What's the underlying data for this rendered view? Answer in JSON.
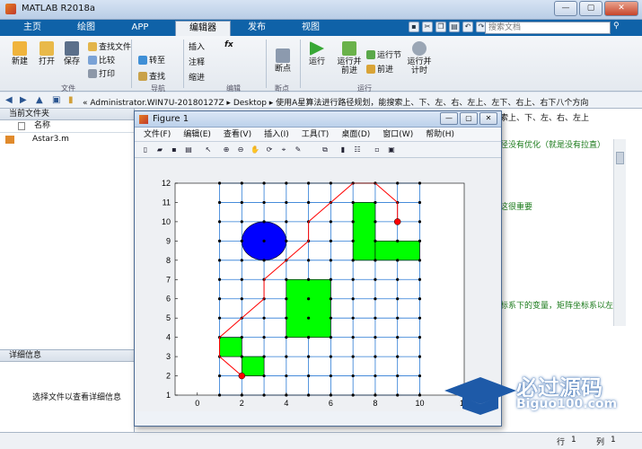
{
  "window": {
    "title": "MATLAB R2018a",
    "min": "—",
    "max": "▢",
    "close": "✕"
  },
  "tabs": [
    "主页",
    "绘图",
    "APP",
    "编辑器",
    "发布",
    "视图"
  ],
  "search": {
    "placeholder": "搜索文档"
  },
  "ribbon": {
    "new": "新建",
    "open": "打开",
    "save": "保存",
    "find_files": "查找文件",
    "compare": "比较",
    "print": "打印",
    "goto": "转至",
    "find": "查找",
    "insert": "插入",
    "comment": "注释",
    "indent": "缩进",
    "breakpoints": "断点",
    "run": "运行",
    "run_advance_1": "运行并",
    "run_advance_2": "前进",
    "run_section": "运行节",
    "advance": "前进",
    "run_time_1": "运行并",
    "run_time_2": "计时",
    "group_file": "文件",
    "group_nav": "导航",
    "group_edit": "编辑",
    "group_bp": "断点",
    "group_run": "运行"
  },
  "address": {
    "path": "« Administrator.WIN7U-20180127Z ▸ Desktop ▸ 使用A星算法进行路径规划，能搜索上、下、左、右、左上、左下、右上、右下八个方向"
  },
  "left_panel": {
    "header": "当前文件夹",
    "col_name": "名称",
    "files": [
      "Astar3.m"
    ],
    "detail_header": "详细信息",
    "detail_text": "选择文件以查看详细信息"
  },
  "editor": {
    "lines": [
      "索上、下、左、右、左上",
      "径没有优化（就是没有拉直）",
      "这很重要",
      "标系下的变量，矩阵坐标系以左"
    ]
  },
  "statusbar": {
    "row_label": "行",
    "row": "1",
    "col_label": "列",
    "col": "1"
  },
  "figure": {
    "title": "Figure 1",
    "menu": [
      "文件(F)",
      "编辑(E)",
      "查看(V)",
      "插入(I)",
      "工具(T)",
      "桌面(D)",
      "窗口(W)",
      "帮助(H)"
    ]
  },
  "watermark": {
    "text": "必过源码",
    "url": "Biguo100.com"
  },
  "chart_data": {
    "type": "scatter",
    "title": "",
    "xlabel": "",
    "ylabel": "",
    "xlim": [
      -1,
      12
    ],
    "ylim": [
      1,
      12
    ],
    "x_ticks": [
      0,
      2,
      4,
      6,
      8,
      10,
      12
    ],
    "y_ticks": [
      1,
      2,
      3,
      4,
      5,
      6,
      7,
      8,
      9,
      10,
      11,
      12
    ],
    "grid_range": {
      "x": [
        1,
        10
      ],
      "y": [
        1,
        12
      ]
    },
    "obstacles": [
      {
        "shape": "rect",
        "x": [
          1,
          2
        ],
        "y": [
          3,
          4
        ]
      },
      {
        "shape": "rect",
        "x": [
          2,
          3
        ],
        "y": [
          2,
          3
        ]
      },
      {
        "shape": "rect",
        "x": [
          4,
          6
        ],
        "y": [
          4,
          7
        ]
      },
      {
        "shape": "rect",
        "x": [
          7,
          8
        ],
        "y": [
          8,
          11
        ]
      },
      {
        "shape": "rect",
        "x": [
          8,
          10
        ],
        "y": [
          8,
          9
        ]
      }
    ],
    "circle": {
      "cx": 3,
      "cy": 9,
      "r": 1,
      "color": "#0000ff"
    },
    "start": {
      "x": 2,
      "y": 2
    },
    "goal": {
      "x": 9,
      "y": 10
    },
    "path": [
      [
        2,
        2
      ],
      [
        1,
        3
      ],
      [
        1,
        4
      ],
      [
        2,
        5
      ],
      [
        3,
        6
      ],
      [
        3,
        7
      ],
      [
        4,
        8
      ],
      [
        5,
        9
      ],
      [
        5,
        10
      ],
      [
        6,
        11
      ],
      [
        7,
        12
      ],
      [
        8,
        12
      ],
      [
        9,
        11
      ],
      [
        9,
        10
      ]
    ],
    "colors": {
      "grid": "#2b7bd6",
      "obstacle": "#00ff00",
      "path": "#ff0000",
      "node": "#000000"
    }
  }
}
